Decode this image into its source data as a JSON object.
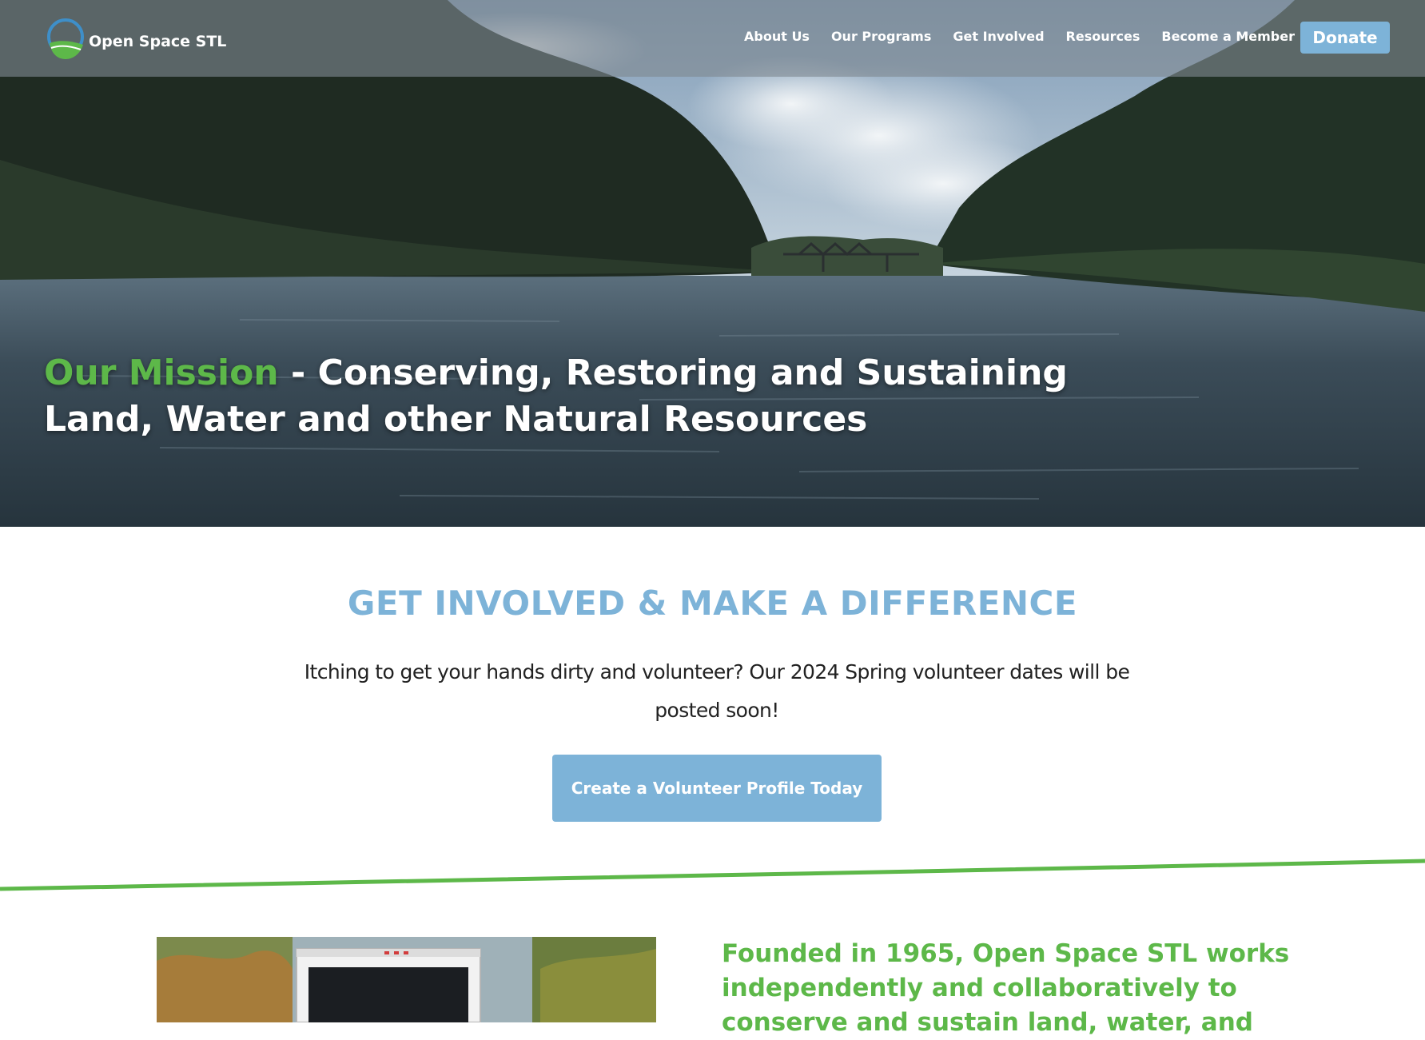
{
  "nav": {
    "logo_text": "Open Space STL",
    "items": [
      {
        "label": "About Us"
      },
      {
        "label": "Our Programs"
      },
      {
        "label": "Get Involved"
      },
      {
        "label": "Resources"
      },
      {
        "label": "Become a Member"
      }
    ],
    "donate_label": "Donate"
  },
  "hero": {
    "mission_accent": "Our Mission",
    "mission_text": " - Conserving, Restoring and Sustaining Land, Water and other Natural Resources"
  },
  "involved": {
    "title": "GET INVOLVED & MAKE A DIFFERENCE",
    "text": "Itching to get your hands dirty and volunteer? Our 2024 Spring volunteer dates will be posted soon!",
    "button_label": "Create a Volunteer Profile Today"
  },
  "about": {
    "heading": "Founded in 1965, Open Space STL works independently and collaboratively to conserve and sustain land, water, and"
  },
  "colors": {
    "brand_green": "#5db849",
    "brand_blue": "#7db3d8"
  }
}
